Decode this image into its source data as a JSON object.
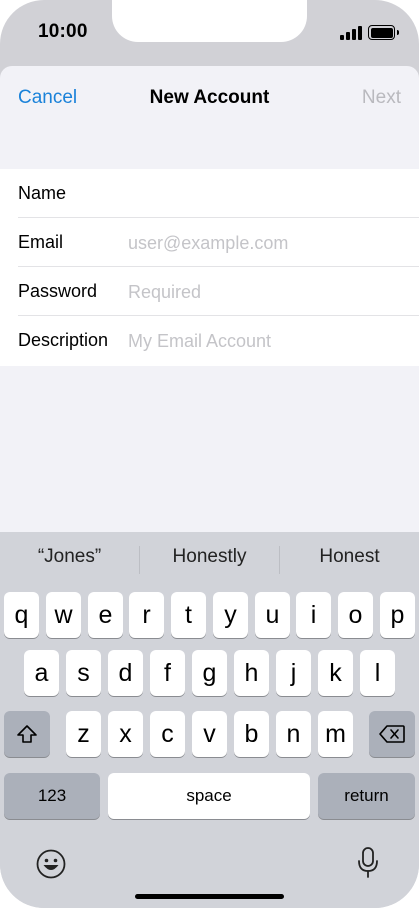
{
  "status": {
    "time": "10:00"
  },
  "nav": {
    "cancel": "Cancel",
    "title": "New Account",
    "next": "Next"
  },
  "form": {
    "rows": [
      {
        "label": "Name",
        "value": "",
        "placeholder": ""
      },
      {
        "label": "Email",
        "value": "",
        "placeholder": "user@example.com"
      },
      {
        "label": "Password",
        "value": "",
        "placeholder": "Required"
      },
      {
        "label": "Description",
        "value": "",
        "placeholder": "My Email Account"
      }
    ]
  },
  "keyboard": {
    "suggestions": [
      "“Jones”",
      "Honestly",
      "Honest"
    ],
    "row1": [
      "q",
      "w",
      "e",
      "r",
      "t",
      "y",
      "u",
      "i",
      "o",
      "p"
    ],
    "row2": [
      "a",
      "s",
      "d",
      "f",
      "g",
      "h",
      "j",
      "k",
      "l"
    ],
    "row3": [
      "z",
      "x",
      "c",
      "v",
      "b",
      "n",
      "m"
    ],
    "numbers_key": "123",
    "space_key": "space",
    "return_key": "return",
    "icons": {
      "shift": "shift-icon",
      "delete": "delete-icon",
      "emoji": "emoji-icon",
      "mic": "microphone-icon"
    }
  }
}
